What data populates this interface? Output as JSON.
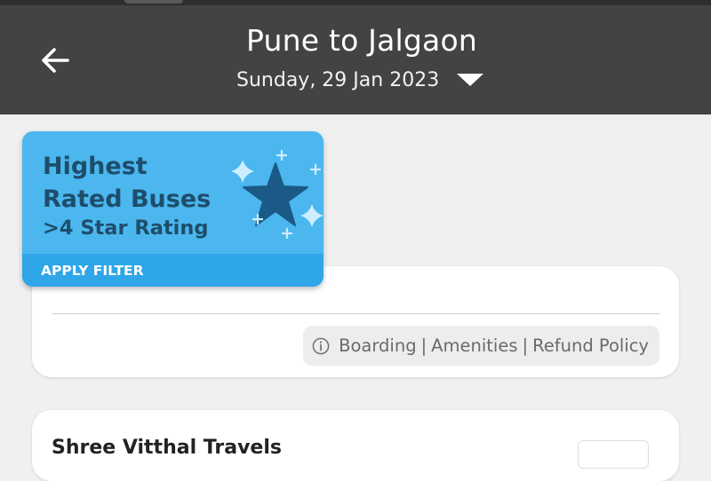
{
  "header": {
    "title": "Pune to Jalgaon",
    "date": "Sunday, 29 Jan 2023",
    "back_icon": "arrow-left-icon",
    "date_dropdown_icon": "caret-down-icon",
    "background": "#434343"
  },
  "banner": {
    "line1": "Highest",
    "line2": "Rated Buses",
    "line3": ">4 Star Rating",
    "action": "APPLY FILTER",
    "icon": "star-icon",
    "background": "#4bb7ee",
    "star_color": "#1b5a86"
  },
  "bus_card": {
    "info_links": [
      "Boarding",
      "Amenities",
      "Refund Policy"
    ],
    "info_icon": "info-circle-icon"
  },
  "next_card": {
    "operator": "Shree Vitthal Travels"
  }
}
